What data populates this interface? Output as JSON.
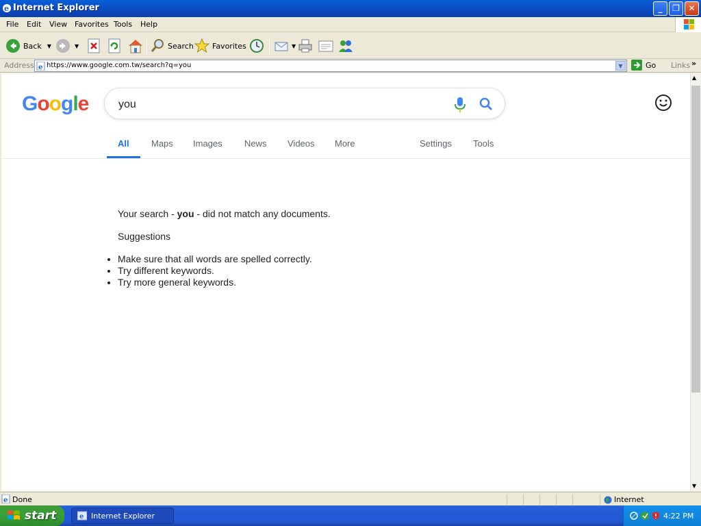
{
  "window": {
    "title": "Internet Explorer"
  },
  "menu": [
    "File",
    "Edit",
    "View",
    "Favorites",
    "Tools",
    "Help"
  ],
  "toolbar": {
    "back": "Back",
    "search": "Search",
    "favorites": "Favorites"
  },
  "address": {
    "label": "Address",
    "url": "https://www.google.com.tw/search?q=you",
    "go": "Go",
    "links": "Links"
  },
  "google": {
    "logo_letters": [
      {
        "ch": "G",
        "color": "#4285f4"
      },
      {
        "ch": "o",
        "color": "#ea4335"
      },
      {
        "ch": "o",
        "color": "#fbbc05"
      },
      {
        "ch": "g",
        "color": "#4285f4"
      },
      {
        "ch": "l",
        "color": "#34a853"
      },
      {
        "ch": "e",
        "color": "#ea4335"
      }
    ],
    "query": "you",
    "tabs": {
      "all": "All",
      "maps": "Maps",
      "images": "Images",
      "news": "News",
      "videos": "Videos",
      "more": "More",
      "settings": "Settings",
      "tools": "Tools"
    },
    "no_result": {
      "prefix": "Your search - ",
      "term": "you",
      "suffix": " - did not match any documents."
    },
    "suggestions_title": "Suggestions",
    "suggestions": [
      "Make sure that all words are spelled correctly.",
      "Try different keywords.",
      "Try more general keywords."
    ]
  },
  "status": {
    "text": "Done",
    "zone": "Internet"
  },
  "taskbar": {
    "start": "start",
    "task": "Internet Explorer",
    "clock": "4:22 PM"
  }
}
